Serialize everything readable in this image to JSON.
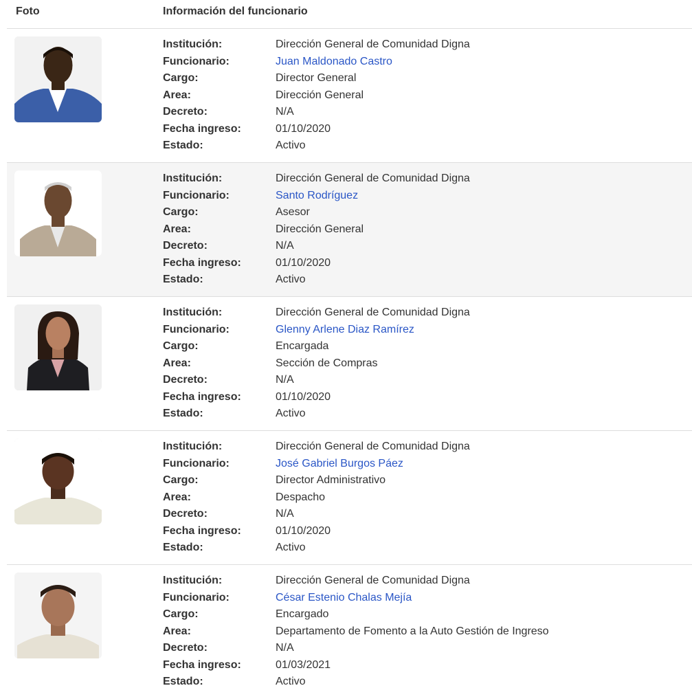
{
  "header": {
    "foto": "Foto",
    "info": "Información del funcionario"
  },
  "labels": {
    "institucion": "Institución:",
    "funcionario": "Funcionario:",
    "cargo": "Cargo:",
    "area": "Area:",
    "decreto": "Decreto:",
    "fecha": "Fecha ingreso:",
    "estado": "Estado:"
  },
  "colors": {
    "link": "#2a56c6",
    "stripe": "#f5f5f5",
    "border": "#dddddd"
  },
  "rows": [
    {
      "institucion": "Dirección General de Comunidad Digna",
      "funcionario": "Juan Maldonado Castro",
      "cargo": "Director General",
      "area": "Dirección General",
      "decreto": "N/A",
      "fecha": "01/10/2020",
      "estado": "Activo"
    },
    {
      "institucion": "Dirección General de Comunidad Digna",
      "funcionario": "Santo Rodríguez",
      "cargo": "Asesor",
      "area": "Dirección General",
      "decreto": "N/A",
      "fecha": "01/10/2020",
      "estado": "Activo"
    },
    {
      "institucion": "Dirección General de Comunidad Digna",
      "funcionario": "Glenny Arlene Diaz Ramírez",
      "cargo": "Encargada",
      "area": "Sección de Compras",
      "decreto": "N/A",
      "fecha": "01/10/2020",
      "estado": "Activo"
    },
    {
      "institucion": "Dirección General de Comunidad Digna",
      "funcionario": "José Gabriel Burgos Páez",
      "cargo": "Director Administrativo",
      "area": "Despacho",
      "decreto": "N/A",
      "fecha": "01/10/2020",
      "estado": "Activo"
    },
    {
      "institucion": "Dirección General de Comunidad Digna",
      "funcionario": "César Estenio Chalas Mejía",
      "cargo": "Encargado",
      "area": "Departamento de Fomento a la Auto Gestión de Ingreso",
      "decreto": "N/A",
      "fecha": "01/03/2021",
      "estado": "Activo"
    }
  ]
}
